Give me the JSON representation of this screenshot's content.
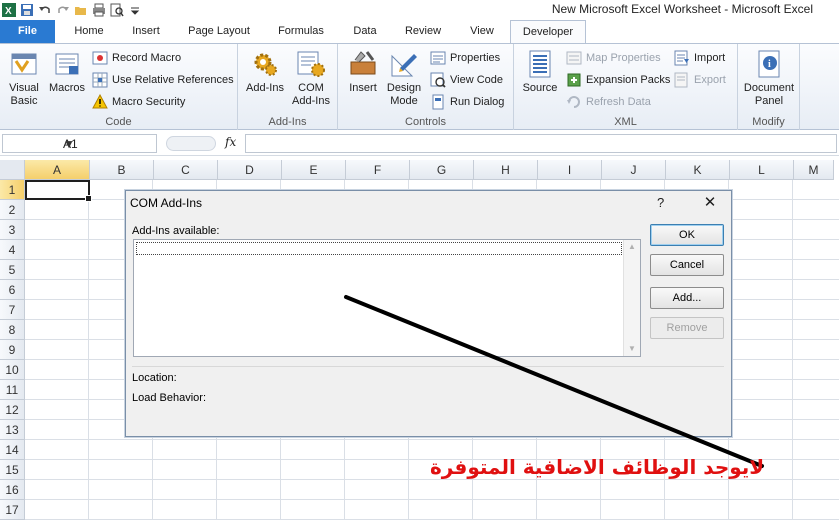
{
  "window": {
    "title": "New Microsoft Excel Worksheet  -  Microsoft Excel"
  },
  "tabs": [
    {
      "label": "File"
    },
    {
      "label": "Home"
    },
    {
      "label": "Insert"
    },
    {
      "label": "Page Layout"
    },
    {
      "label": "Formulas"
    },
    {
      "label": "Data"
    },
    {
      "label": "Review"
    },
    {
      "label": "View"
    },
    {
      "label": "Developer"
    }
  ],
  "ribbon": {
    "code": {
      "label": "Code",
      "visual_basic": "Visual Basic",
      "macros": "Macros",
      "record_macro": "Record Macro",
      "relative_refs": "Use Relative References",
      "macro_security": "Macro Security"
    },
    "addins": {
      "label": "Add-Ins",
      "addins": "Add-Ins",
      "com_addins": "COM Add-Ins"
    },
    "controls": {
      "label": "Controls",
      "insert": "Insert",
      "design_mode": "Design Mode",
      "properties": "Properties",
      "view_code": "View Code",
      "run_dialog": "Run Dialog"
    },
    "xml": {
      "label": "XML",
      "source": "Source",
      "map_properties": "Map Properties",
      "expansion_packs": "Expansion Packs",
      "refresh_data": "Refresh Data",
      "import": "Import",
      "export": "Export"
    },
    "modify": {
      "label": "Modify",
      "document_panel": "Document Panel"
    }
  },
  "formula_bar": {
    "name_box": "A1",
    "fx": "fx",
    "value": ""
  },
  "grid": {
    "columns": [
      "A",
      "B",
      "C",
      "D",
      "E",
      "F",
      "G",
      "H",
      "I",
      "J",
      "K",
      "L",
      "M"
    ],
    "rows": [
      "1",
      "2",
      "3",
      "4",
      "5",
      "6",
      "7",
      "8",
      "9",
      "10",
      "11",
      "12",
      "13",
      "14",
      "15",
      "16",
      "17"
    ],
    "active_cell": "A1"
  },
  "dialog": {
    "title": "COM Add-Ins",
    "help": "?",
    "close": "✕",
    "available_label": "Add-Ins available:",
    "location_label": "Location:",
    "load_behavior_label": "Load Behavior:",
    "ok": "OK",
    "cancel": "Cancel",
    "add": "Add...",
    "remove": "Remove"
  },
  "annotation": {
    "text": "لايوجد الوظائف الاضافية المتوفرة",
    "color": "#e01010"
  },
  "colors": {
    "file_tab": "#2a7ad2",
    "selection": "#f5cf6b"
  }
}
